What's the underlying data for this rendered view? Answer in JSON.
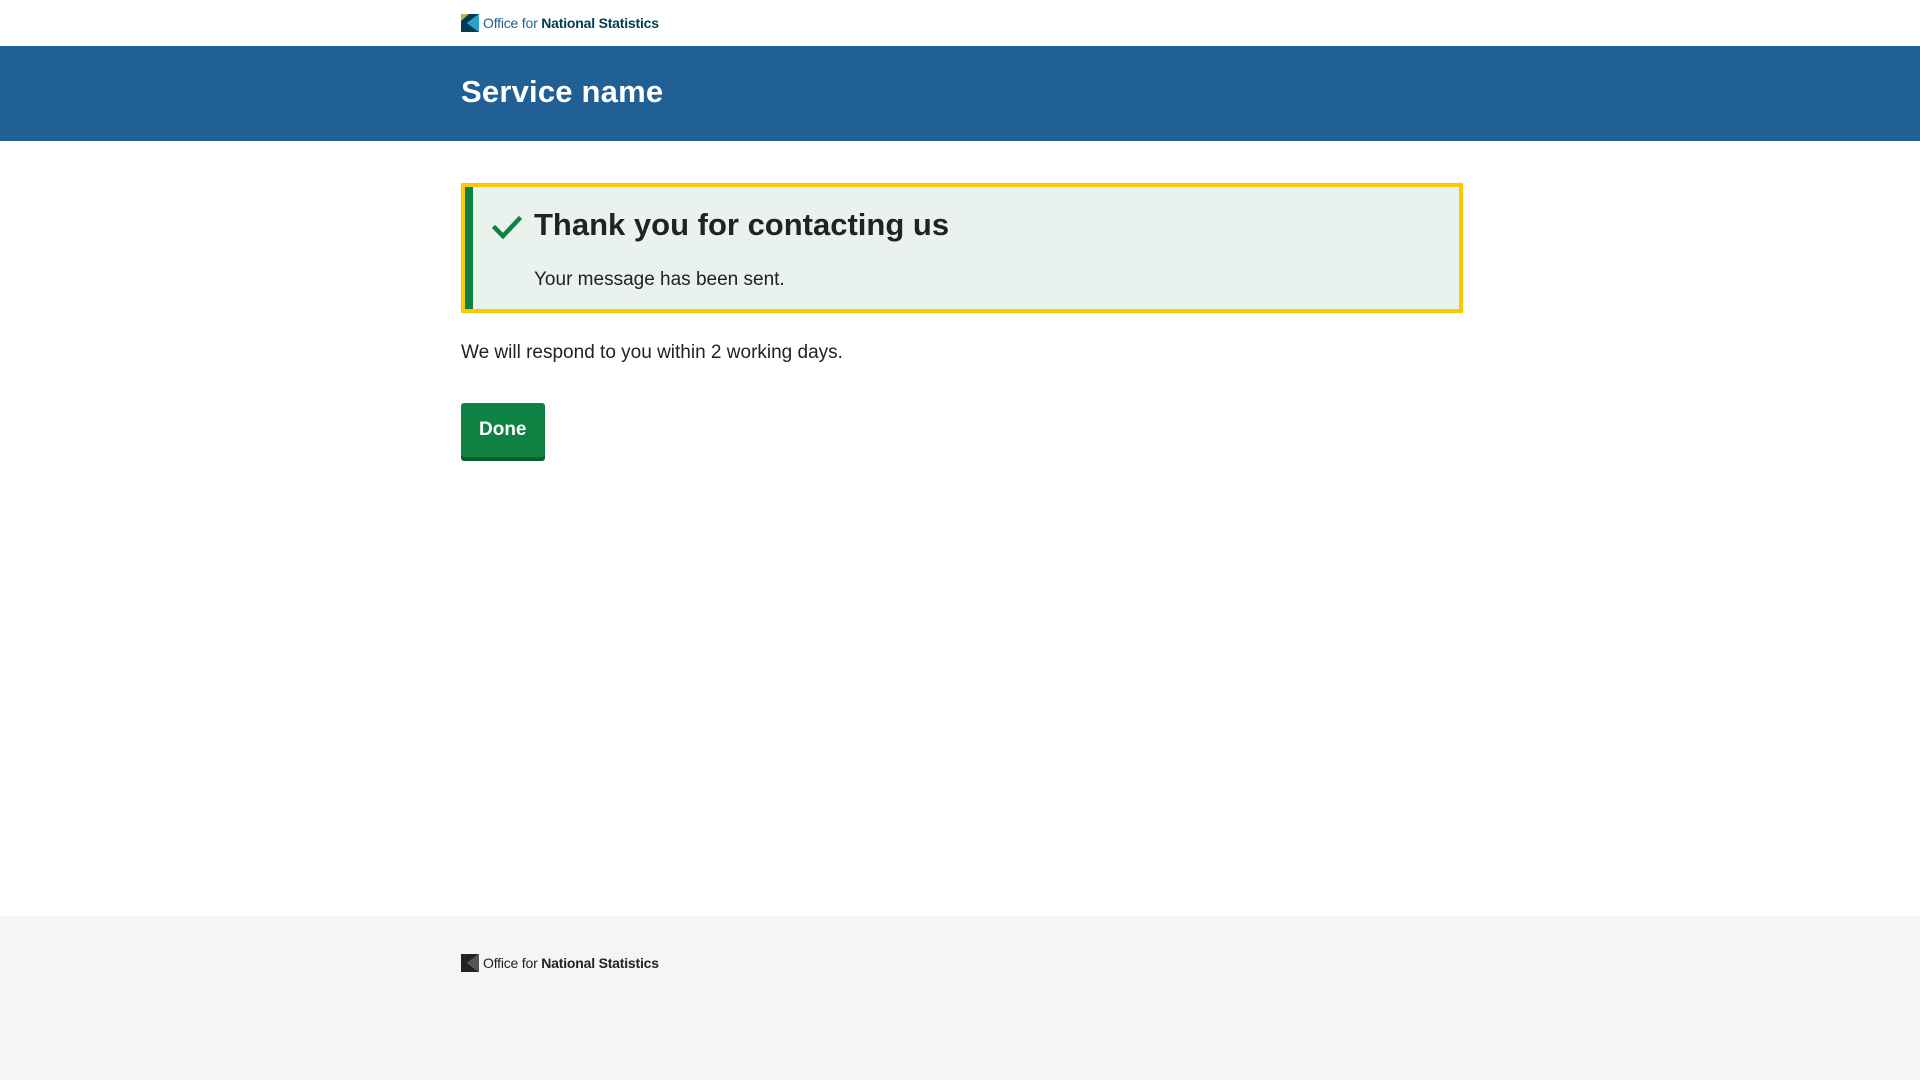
{
  "header": {
    "logo": {
      "text_prefix": "Office for",
      "text_bold": "National Statistics",
      "icon": "ons-logo-icon"
    },
    "service_name": "Service name"
  },
  "panel": {
    "icon": "check-icon",
    "title": "Thank you for contacting us",
    "body": "Your message has been sent."
  },
  "main": {
    "message": "We will respond to you within 2 working days.",
    "done_label": "Done"
  },
  "footer": {
    "logo": {
      "text_prefix": "Office for",
      "text_bold": "National Statistics",
      "icon": "ons-logo-icon"
    }
  },
  "colors": {
    "brand_blue": "#206095",
    "success_green": "#0f8243",
    "focus_yellow": "#fbc900",
    "panel_background": "#e9f2ec",
    "footer_background": "#f5f5f5"
  }
}
